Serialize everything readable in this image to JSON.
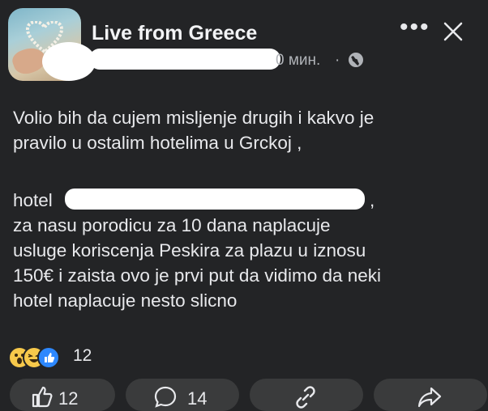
{
  "post": {
    "page_name": "Live from Greece",
    "time": "0 мин.",
    "separator": "·",
    "privacy_icon": "globe-icon",
    "more_icon": "more-icon",
    "close_icon": "close-icon",
    "text_para1": "Volio bih da cujem misljenje drugih  i kakvo je\npravilo u ostalim hotelima u Grckoj ,",
    "text_para2_start": "hotel",
    "text_para2_end": ",",
    "text_para2_rest": "za nasu porodicu za 10 dana naplacuje\nusluge koriscenja Peskira za plazu u iznosu\n150€ i zaista ovo je prvi put da vidimo da neki\nhotel naplacuje nesto slicno"
  },
  "reactions": {
    "icons": [
      "wow-icon",
      "haha-icon",
      "like-icon"
    ],
    "count": "12"
  },
  "actions": {
    "like_count": "12",
    "comment_count": "14",
    "share_icon": "link-icon",
    "forward_icon": "share-icon"
  },
  "colors": {
    "background": "#232426",
    "button_bg": "#3a3b3c",
    "text": "#e8e9ec",
    "muted": "#b0b3b8",
    "like_blue": "#2d88ff",
    "emoji_yellow": "#f7c94b"
  }
}
